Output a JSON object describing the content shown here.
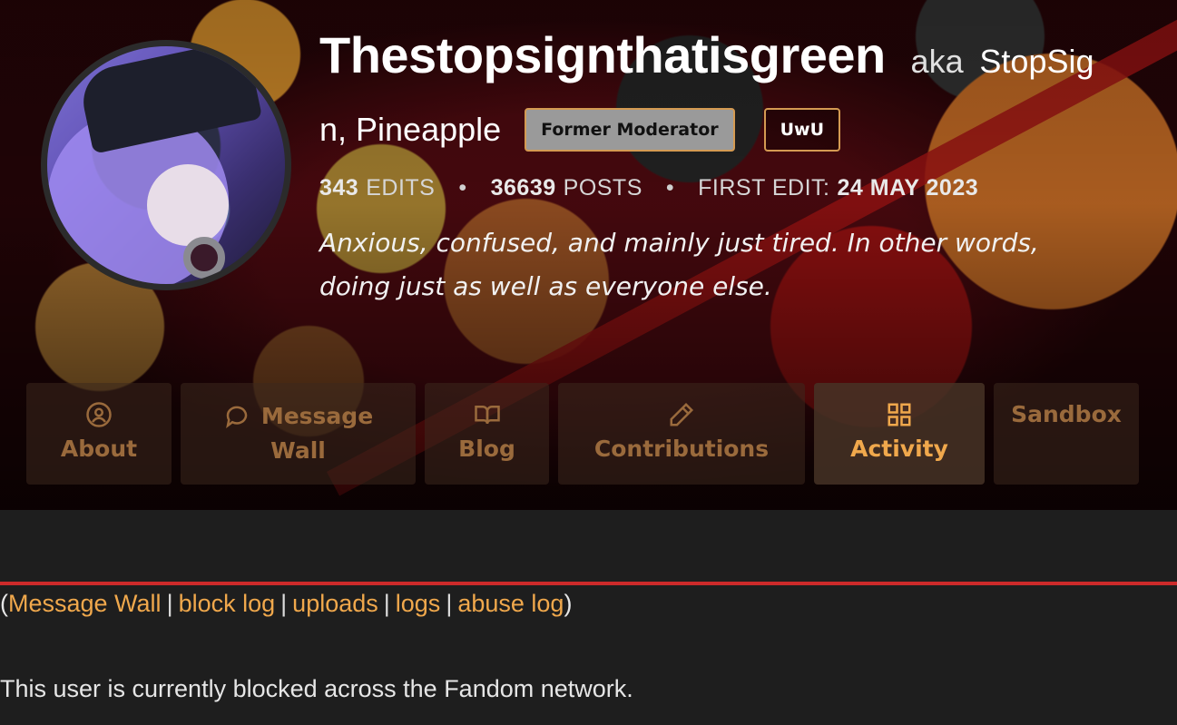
{
  "profile": {
    "username": "Thestopsignthatisgreen",
    "aka_label": "aka",
    "aka_line1": "StopSig",
    "aka_line2": "n, Pineapple",
    "tags": [
      "Former Moderator",
      "UwU"
    ],
    "stats": {
      "edits_value": "343",
      "edits_label": "EDITS",
      "posts_value": "36639",
      "posts_label": "POSTS",
      "first_edit_label": "FIRST EDIT:",
      "first_edit_value": "24 MAY 2023",
      "separator": "•"
    },
    "bio_line1": "Anxious, confused, and mainly just tired. In other words,",
    "bio_line2": "doing just as well as everyone else."
  },
  "tabs": {
    "about": "About",
    "message_wall_l1": "Message",
    "message_wall_l2": "Wall",
    "blog": "Blog",
    "contributions": "Contributions",
    "activity": "Activity",
    "sandbox": "Sandbox",
    "active": "activity",
    "icons": {
      "about": "user-circle-icon",
      "message_wall": "speech-bubble-icon",
      "blog": "open-book-icon",
      "contributions": "pencil-icon",
      "activity": "grid-icon"
    }
  },
  "links": {
    "open": "(",
    "close": ")",
    "sep": "|",
    "message_wall": "Message Wall",
    "block_log": "block log",
    "uploads": "uploads",
    "logs": "logs",
    "abuse_log": "abuse log"
  },
  "notice": "This user is currently blocked across the Fandom network.",
  "colors": {
    "accent": "#f0a84c",
    "page_bg": "#1e1e1e",
    "divider": "#cc2a2a",
    "tag_border": "#d49a52"
  }
}
